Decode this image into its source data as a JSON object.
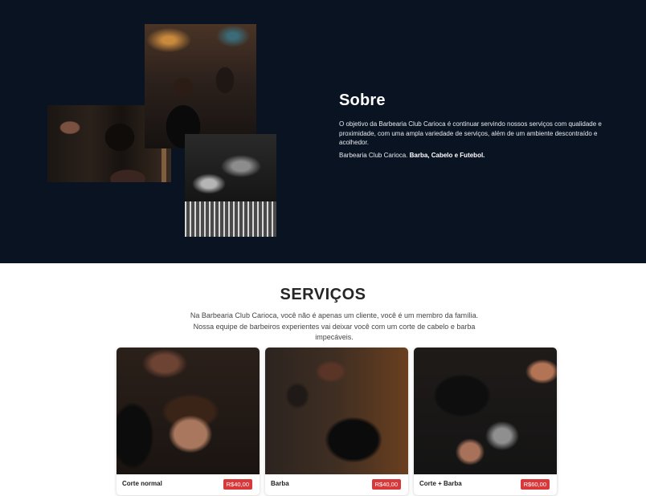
{
  "about": {
    "title": "Sobre",
    "description": "O objetivo da Barbearia Club Carioca é continuar servindo nossos serviços com qualidade e proximidade, com uma ampla variedade de serviços, além de um ambiente descontraído e acolhedor.",
    "tagline_prefix": "Barbearia Club Carioca. ",
    "tagline_bold": "Barba, Cabelo e Futebol.",
    "colors": {
      "background": "#0a1322",
      "text": "#ffffff"
    }
  },
  "services": {
    "title": "SERVIÇOS",
    "description": "Na Barbearia Club Carioca, você não é apenas um cliente, você é um membro da família. Nossa equipe de barbeiros experientes vai deixar você com um corte de cabelo e barba impecáveis.",
    "items": [
      {
        "name": "Corte normal",
        "price": "R$40,00"
      },
      {
        "name": "Barba",
        "price": "R$40,00"
      },
      {
        "name": "Corte + Barba",
        "price": "R$60,00"
      }
    ],
    "colors": {
      "price_badge": "#d9383a"
    }
  }
}
